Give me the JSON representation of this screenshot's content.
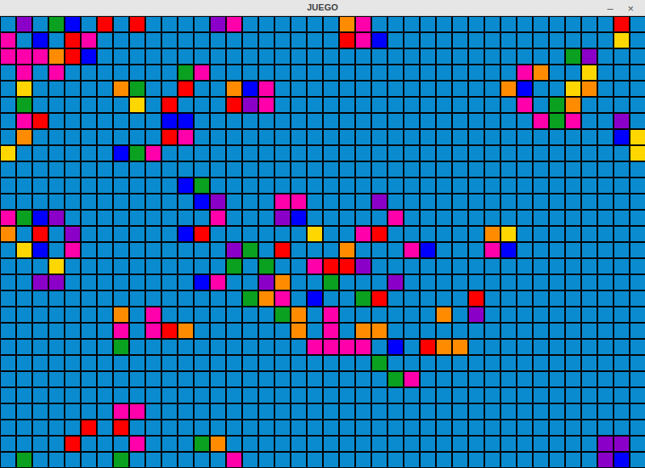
{
  "window": {
    "title": "JUEGO",
    "controls": [
      "–",
      "×"
    ]
  },
  "board": {
    "palette": {
      ".": "#0a8bcf",
      "P": "#8b00c9",
      "G": "#0aa020",
      "B": "#0000ff",
      "R": "#ff0000",
      "O": "#ff8c00",
      "M": "#ff00aa",
      "Y": "#ffd700"
    },
    "rows": [
      ".P.GB.R.R....PM......OM...............R.",
      "M.B.RM...............RMB..............Y.",
      "MMMORB.............................GP...",
      ".M.M.......GM...................MO..Y...",
      ".Y.....OG..R..OBM..............OB..YO...",
      ".G......Y.R...RPM...............M.GO....",
      ".MR.......BB.....................MGM..P.",
      ".O........RM..........................BY",
      "Y......BGM.............................Y",
      "........................................",
      "...........BG...........................",
      "............BP...MM....P................",
      "MGBP.........M...PB.....M...............",
      "O.R.P......BR......Y..MR......OY........",
      ".YB.M.........PG.R...O...MB...MB........",
      "...Y..........G.G..MRRP.................",
      "..PP........BM..PO..G...P...............",
      "...............GOM.B..GR.....R..........",
      ".......O.M.......GO.M......O.P..........",
      ".......M.MRO......O.M.OO................",
      ".......G...........MMMM.B.ROO...........",
      ".......................G................",
      "........................GM..............",
      "........................................",
      ".......MM...............................",
      ".....R.R................................",
      "....R...M...GO.......................PP.",
      ".G.....G......M......................PB."
    ]
  }
}
